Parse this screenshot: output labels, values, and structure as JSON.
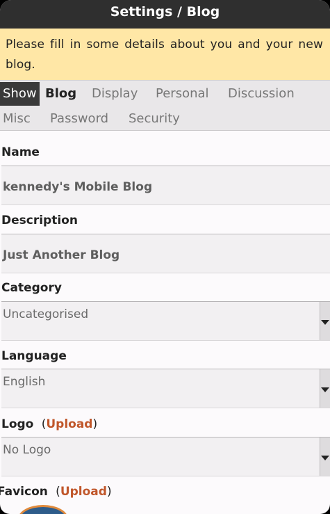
{
  "title": "Settings  / Blog",
  "notice": "Please fill in some details about you and your new blog.",
  "tabs": {
    "show": "Show",
    "items": [
      "Blog",
      "Display",
      "Personal",
      "Discussion",
      "Misc",
      "Password",
      "Security"
    ],
    "selected": "Blog"
  },
  "form": {
    "name_label": "Name",
    "name_value": "kennedy's Mobile Blog",
    "description_label": "Description",
    "description_value": "Just Another Blog",
    "category_label": "Category",
    "category_value": "Uncategorised",
    "language_label": "Language",
    "language_value": "English",
    "logo_label": "Logo",
    "logo_upload": "Upload",
    "logo_value": "No Logo",
    "favicon_label": "Favicon",
    "favicon_upload": "Upload"
  },
  "colors": {
    "titlebar": "#2f2f2f",
    "notice_bg": "#ffe7a6",
    "upload_link": "#c0562a"
  }
}
